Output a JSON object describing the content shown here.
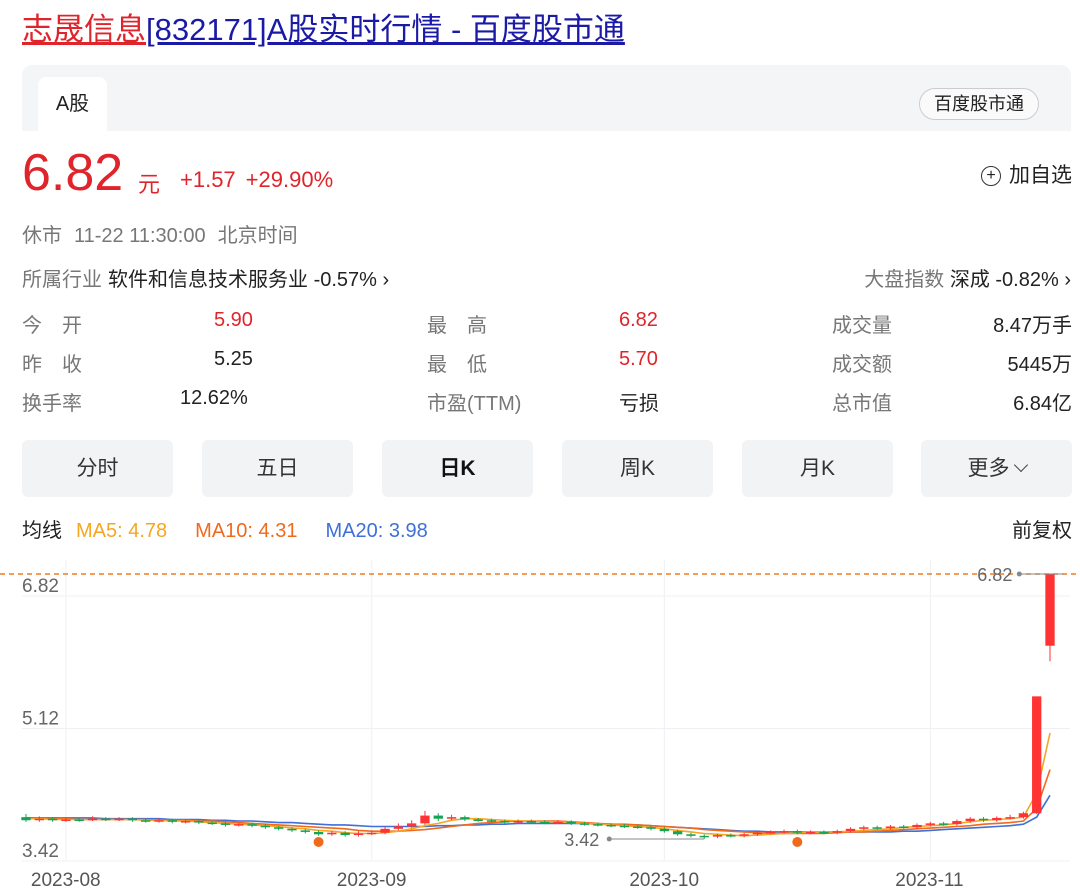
{
  "page_title": {
    "stock_name": "志晟信息",
    "rest": "[832171]A股实时行情 - 百度股市通"
  },
  "tab": {
    "label": "A股"
  },
  "brand": {
    "label": "百度股市通"
  },
  "quote": {
    "price": "6.82",
    "unit": "元",
    "change": "+1.57",
    "change_pct": "+29.90%",
    "add_watch": "加自选",
    "plus_glyph": "+",
    "status": "休市",
    "datetime": "11-22 11:30:00",
    "timezone": "北京时间"
  },
  "industry": {
    "label": "所属行业",
    "name": "软件和信息技术服务业",
    "change": "-0.57%",
    "arrow": "›"
  },
  "index": {
    "label": "大盘指数",
    "name": "深成",
    "change": "-0.82%",
    "arrow": "›"
  },
  "stats": [
    {
      "label": "今　开",
      "value": "5.90",
      "color": "#e0242b"
    },
    {
      "label": "昨　收",
      "value": "5.25",
      "color": "#222222"
    },
    {
      "label": "换手率",
      "value": "12.62%",
      "color": "#222222"
    },
    {
      "label": "最　高",
      "value": "6.82",
      "color": "#e0242b"
    },
    {
      "label": "最　低",
      "value": "5.70",
      "color": "#e0242b"
    },
    {
      "label": "市盈(TTM)",
      "value": "亏损",
      "color": "#222222"
    },
    {
      "label": "成交量",
      "value": "8.47万手",
      "color": "#222222"
    },
    {
      "label": "成交额",
      "value": "5445万",
      "color": "#222222"
    },
    {
      "label": "总市值",
      "value": "6.84亿",
      "color": "#222222"
    }
  ],
  "period_tabs": [
    "分时",
    "五日",
    "日K",
    "周K",
    "月K",
    "更多"
  ],
  "ma": {
    "label": "均线",
    "ma5": "MA5: 4.78",
    "ma10": "MA10: 4.31",
    "ma20": "MA20: 3.98",
    "adjust": "前复权"
  },
  "colors": {
    "up": "#ff3333",
    "down": "#13a552",
    "ma5": "#f5a623",
    "ma10": "#f06a1e",
    "ma20": "#3f6fd8",
    "ref_line": "#f07b22",
    "marker": "#f06a1e"
  },
  "chart_data": {
    "type": "candlestick",
    "y_ticks": [
      "6.82",
      "5.12",
      "3.42"
    ],
    "ylim": [
      3.15,
      7.0
    ],
    "x_ticks": [
      "2023-08",
      "2023-09",
      "2023-10",
      "2023-11"
    ],
    "x_tick_index": [
      3,
      26,
      48,
      68
    ],
    "reference_line": 6.82,
    "max_label": "6.82",
    "max_index": 78,
    "min_label": "3.42",
    "min_index": 51,
    "markers_index": [
      22,
      58
    ],
    "candles": [
      [
        3.7,
        3.66,
        3.74,
        3.64
      ],
      [
        3.66,
        3.68,
        3.71,
        3.64
      ],
      [
        3.68,
        3.66,
        3.7,
        3.64
      ],
      [
        3.66,
        3.67,
        3.7,
        3.64
      ],
      [
        3.67,
        3.66,
        3.69,
        3.64
      ],
      [
        3.66,
        3.68,
        3.71,
        3.65
      ],
      [
        3.68,
        3.67,
        3.7,
        3.65
      ],
      [
        3.67,
        3.68,
        3.7,
        3.65
      ],
      [
        3.68,
        3.66,
        3.7,
        3.64
      ],
      [
        3.66,
        3.65,
        3.68,
        3.63
      ],
      [
        3.65,
        3.66,
        3.69,
        3.63
      ],
      [
        3.66,
        3.64,
        3.68,
        3.62
      ],
      [
        3.64,
        3.65,
        3.67,
        3.62
      ],
      [
        3.65,
        3.63,
        3.67,
        3.61
      ],
      [
        3.63,
        3.62,
        3.65,
        3.6
      ],
      [
        3.62,
        3.6,
        3.64,
        3.58
      ],
      [
        3.6,
        3.61,
        3.63,
        3.58
      ],
      [
        3.61,
        3.59,
        3.63,
        3.57
      ],
      [
        3.59,
        3.57,
        3.61,
        3.55
      ],
      [
        3.57,
        3.55,
        3.59,
        3.53
      ],
      [
        3.55,
        3.53,
        3.57,
        3.51
      ],
      [
        3.53,
        3.51,
        3.55,
        3.49
      ],
      [
        3.51,
        3.48,
        3.53,
        3.46
      ],
      [
        3.48,
        3.5,
        3.52,
        3.46
      ],
      [
        3.5,
        3.47,
        3.52,
        3.45
      ],
      [
        3.47,
        3.49,
        3.52,
        3.45
      ],
      [
        3.49,
        3.5,
        3.53,
        3.47
      ],
      [
        3.5,
        3.55,
        3.58,
        3.48
      ],
      [
        3.55,
        3.58,
        3.62,
        3.53
      ],
      [
        3.58,
        3.62,
        3.66,
        3.56
      ],
      [
        3.62,
        3.72,
        3.78,
        3.6
      ],
      [
        3.72,
        3.68,
        3.75,
        3.65
      ],
      [
        3.68,
        3.7,
        3.73,
        3.66
      ],
      [
        3.7,
        3.67,
        3.72,
        3.65
      ],
      [
        3.67,
        3.66,
        3.69,
        3.64
      ],
      [
        3.66,
        3.65,
        3.68,
        3.63
      ],
      [
        3.65,
        3.64,
        3.67,
        3.62
      ],
      [
        3.64,
        3.65,
        3.67,
        3.62
      ],
      [
        3.65,
        3.64,
        3.67,
        3.62
      ],
      [
        3.64,
        3.63,
        3.66,
        3.61
      ],
      [
        3.63,
        3.64,
        3.66,
        3.61
      ],
      [
        3.64,
        3.62,
        3.66,
        3.6
      ],
      [
        3.62,
        3.61,
        3.64,
        3.59
      ],
      [
        3.61,
        3.6,
        3.63,
        3.58
      ],
      [
        3.6,
        3.59,
        3.62,
        3.57
      ],
      [
        3.59,
        3.58,
        3.61,
        3.56
      ],
      [
        3.58,
        3.57,
        3.6,
        3.55
      ],
      [
        3.57,
        3.55,
        3.59,
        3.53
      ],
      [
        3.55,
        3.52,
        3.57,
        3.5
      ],
      [
        3.52,
        3.48,
        3.54,
        3.46
      ],
      [
        3.48,
        3.46,
        3.5,
        3.44
      ],
      [
        3.46,
        3.45,
        3.48,
        3.42
      ],
      [
        3.45,
        3.47,
        3.49,
        3.43
      ],
      [
        3.47,
        3.46,
        3.49,
        3.44
      ],
      [
        3.46,
        3.48,
        3.5,
        3.44
      ],
      [
        3.48,
        3.5,
        3.52,
        3.46
      ],
      [
        3.5,
        3.51,
        3.53,
        3.48
      ],
      [
        3.51,
        3.52,
        3.54,
        3.49
      ],
      [
        3.52,
        3.5,
        3.54,
        3.48
      ],
      [
        3.5,
        3.51,
        3.53,
        3.48
      ],
      [
        3.51,
        3.5,
        3.53,
        3.48
      ],
      [
        3.5,
        3.52,
        3.54,
        3.48
      ],
      [
        3.52,
        3.55,
        3.57,
        3.5
      ],
      [
        3.55,
        3.57,
        3.59,
        3.53
      ],
      [
        3.57,
        3.56,
        3.59,
        3.54
      ],
      [
        3.56,
        3.58,
        3.6,
        3.54
      ],
      [
        3.58,
        3.57,
        3.6,
        3.55
      ],
      [
        3.57,
        3.6,
        3.62,
        3.55
      ],
      [
        3.6,
        3.62,
        3.64,
        3.58
      ],
      [
        3.62,
        3.61,
        3.64,
        3.59
      ],
      [
        3.61,
        3.65,
        3.67,
        3.59
      ],
      [
        3.65,
        3.68,
        3.7,
        3.63
      ],
      [
        3.68,
        3.66,
        3.7,
        3.64
      ],
      [
        3.66,
        3.69,
        3.71,
        3.64
      ],
      [
        3.69,
        3.7,
        3.73,
        3.67
      ],
      [
        3.7,
        3.75,
        3.77,
        3.68
      ],
      [
        3.75,
        5.25,
        5.25,
        3.74
      ],
      [
        5.9,
        6.82,
        6.82,
        5.7
      ]
    ],
    "ma5": [
      3.68,
      3.68,
      3.67,
      3.67,
      3.67,
      3.67,
      3.67,
      3.67,
      3.67,
      3.66,
      3.66,
      3.65,
      3.65,
      3.64,
      3.63,
      3.62,
      3.61,
      3.6,
      3.59,
      3.58,
      3.56,
      3.55,
      3.53,
      3.52,
      3.5,
      3.49,
      3.49,
      3.5,
      3.52,
      3.55,
      3.59,
      3.62,
      3.66,
      3.68,
      3.68,
      3.67,
      3.66,
      3.65,
      3.65,
      3.64,
      3.64,
      3.63,
      3.62,
      3.61,
      3.6,
      3.59,
      3.58,
      3.57,
      3.55,
      3.53,
      3.51,
      3.49,
      3.48,
      3.47,
      3.46,
      3.47,
      3.48,
      3.49,
      3.5,
      3.51,
      3.51,
      3.51,
      3.52,
      3.53,
      3.54,
      3.55,
      3.57,
      3.58,
      3.59,
      3.6,
      3.62,
      3.64,
      3.66,
      3.67,
      3.68,
      3.7,
      4.01,
      4.78
    ],
    "ma10": [
      3.68,
      3.68,
      3.68,
      3.68,
      3.67,
      3.67,
      3.67,
      3.67,
      3.67,
      3.67,
      3.66,
      3.66,
      3.66,
      3.65,
      3.65,
      3.64,
      3.63,
      3.62,
      3.61,
      3.6,
      3.59,
      3.58,
      3.57,
      3.56,
      3.55,
      3.53,
      3.52,
      3.52,
      3.52,
      3.53,
      3.54,
      3.56,
      3.58,
      3.6,
      3.62,
      3.63,
      3.64,
      3.65,
      3.65,
      3.65,
      3.65,
      3.64,
      3.63,
      3.62,
      3.61,
      3.61,
      3.6,
      3.59,
      3.58,
      3.57,
      3.56,
      3.54,
      3.53,
      3.52,
      3.51,
      3.5,
      3.49,
      3.49,
      3.49,
      3.49,
      3.49,
      3.5,
      3.51,
      3.51,
      3.52,
      3.53,
      3.54,
      3.55,
      3.56,
      3.57,
      3.58,
      3.59,
      3.61,
      3.62,
      3.63,
      3.65,
      3.81,
      4.31
    ],
    "ma20": [
      3.69,
      3.69,
      3.69,
      3.69,
      3.69,
      3.69,
      3.68,
      3.68,
      3.68,
      3.68,
      3.68,
      3.67,
      3.67,
      3.67,
      3.66,
      3.66,
      3.65,
      3.65,
      3.64,
      3.63,
      3.63,
      3.62,
      3.61,
      3.6,
      3.6,
      3.59,
      3.58,
      3.58,
      3.58,
      3.58,
      3.58,
      3.59,
      3.59,
      3.6,
      3.6,
      3.61,
      3.61,
      3.62,
      3.62,
      3.62,
      3.62,
      3.62,
      3.62,
      3.61,
      3.61,
      3.6,
      3.6,
      3.59,
      3.58,
      3.57,
      3.56,
      3.55,
      3.54,
      3.53,
      3.52,
      3.52,
      3.51,
      3.51,
      3.51,
      3.51,
      3.51,
      3.51,
      3.51,
      3.51,
      3.51,
      3.51,
      3.52,
      3.52,
      3.53,
      3.54,
      3.55,
      3.56,
      3.57,
      3.58,
      3.59,
      3.61,
      3.7,
      3.98
    ]
  }
}
